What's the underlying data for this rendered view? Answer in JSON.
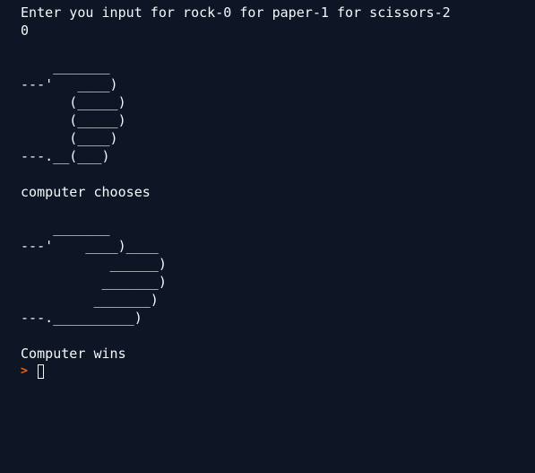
{
  "console": {
    "lines": [
      "Enter you input for rock-0 for paper-1 for scissors-2",
      "0",
      "",
      "    _______",
      "---'   ____)",
      "      (_____)",
      "      (_____)",
      "      (____)",
      "---.__(___)",
      "",
      "computer chooses",
      "",
      "    _______",
      "---'    ____)____",
      "           ______)",
      "          _______)",
      "         _______)",
      "---.__________)",
      "",
      "Computer wins"
    ],
    "prompt_symbol": ">",
    "colors": {
      "background": "#0e1525",
      "text": "#f5f9fc",
      "prompt": "#f26207"
    }
  }
}
